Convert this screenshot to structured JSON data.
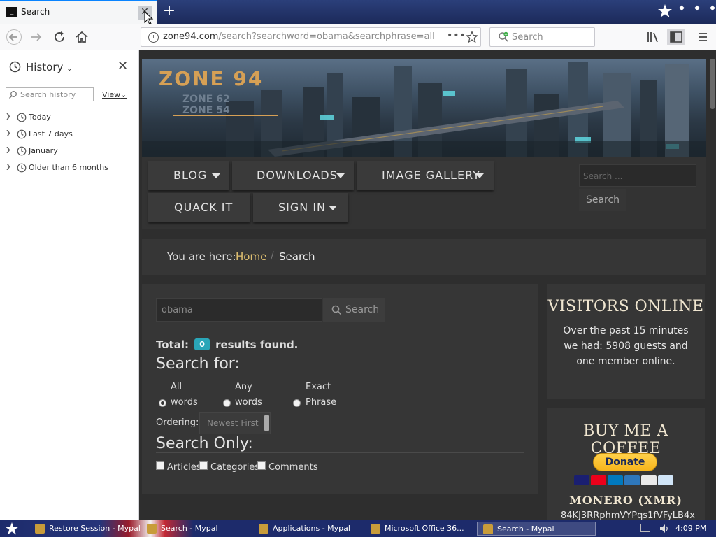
{
  "browser": {
    "tab": {
      "title": "Search",
      "close_icon": "close-icon"
    },
    "url": {
      "host": "zone94.com",
      "path": "/search?searchword=obama&searchphrase=all",
      "more_label": "•••"
    },
    "search_placeholder": "Search"
  },
  "sidebar": {
    "title": "History",
    "search_placeholder": "Search history",
    "view_label": "View",
    "items": [
      {
        "label": "Today"
      },
      {
        "label": "Last 7 days"
      },
      {
        "label": "January"
      },
      {
        "label": "Older than 6 months"
      }
    ]
  },
  "site": {
    "logo": {
      "main": "ZONE 94",
      "sub1": "ZONE 62",
      "sub2": "ZONE 54"
    },
    "menu": [
      {
        "label": "BLOG",
        "has_dropdown": true
      },
      {
        "label": "DOWNLOADS",
        "has_dropdown": true
      },
      {
        "label": "IMAGE GALLERY",
        "has_dropdown": true
      },
      {
        "label": "QUACK IT",
        "has_dropdown": false
      },
      {
        "label": "SIGN IN",
        "has_dropdown": true
      }
    ],
    "search_placeholder": "Search ...",
    "search_button": "Search",
    "breadcrumb": {
      "label": "You are here:",
      "home": "Home",
      "separator": "/",
      "current": "Search"
    },
    "search": {
      "query": "obama",
      "button": "Search",
      "total_label": "Total:",
      "total_count": "0",
      "total_suffix": "results found.",
      "search_for": "Search for:",
      "phrase_options": [
        {
          "top": "All",
          "bottom": "words",
          "selected": true
        },
        {
          "top": "Any",
          "bottom": "words",
          "selected": false
        },
        {
          "top": "Exact",
          "bottom": "Phrase",
          "selected": false
        }
      ],
      "ordering_label": "Ordering:",
      "ordering_value": "Newest First",
      "search_only": "Search Only:",
      "areas": [
        {
          "label": "Articles"
        },
        {
          "label": "Categories"
        },
        {
          "label": "Comments"
        }
      ]
    },
    "visitors": {
      "title": "VISITORS ONLINE",
      "text": "Over the past 15 minutes we had: 5908 guests and one member online."
    },
    "coffee": {
      "title": "BUY ME A COFFEE",
      "donate": "Donate",
      "cards": [
        "#1a1f71",
        "#eb001b",
        "#0079be",
        "#2e77bb",
        "#e9e9e9",
        "#d0e4f7"
      ],
      "monero_title": "MONERO (XMR)",
      "monero_address": "84KJ3RRphmVYPqs1fVFyLB4x"
    }
  },
  "taskbar": {
    "tasks": [
      {
        "label": "Restore Session - Mypal",
        "active": false
      },
      {
        "label": "Search - Mypal",
        "active": false
      },
      {
        "label": "Applications - Mypal",
        "active": false
      },
      {
        "label": "Microsoft Office 36...",
        "active": false
      },
      {
        "label": "Search - Mypal",
        "active": true
      }
    ],
    "clock": "4:09 PM"
  },
  "colors": {
    "page_bg": "#2e2e2e",
    "panel_bg": "#363636",
    "breadcrumb_link": "#e0c070",
    "badge": "#2aa6b8",
    "donate": "#f7b51c"
  }
}
